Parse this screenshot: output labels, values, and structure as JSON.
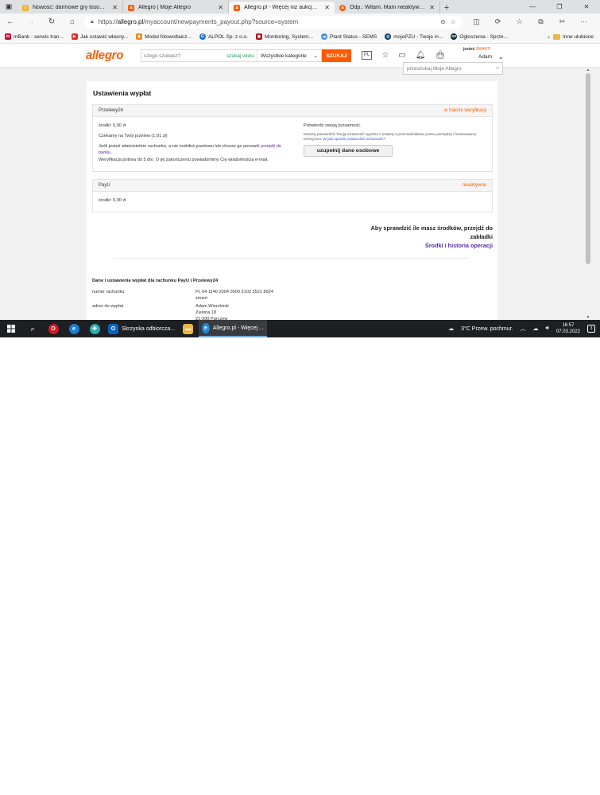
{
  "browser": {
    "tabs": [
      {
        "title": "Nowość: darmowe gry losowe z...",
        "icon": "smiley-icon",
        "color": "#f2b51b",
        "active": false
      },
      {
        "title": "Allegro | Moje Allegro",
        "icon": "allegro-icon",
        "color": "#ff5a00",
        "active": false
      },
      {
        "title": "Allegro.pl - Więcej niż aukcje. Na...",
        "icon": "allegro-icon",
        "color": "#ff5a00",
        "active": true
      },
      {
        "title": "Odp.: Witam. Mam nieaktywną w...",
        "icon": "allegro-icon",
        "color": "#ff5a00",
        "active": false
      }
    ],
    "url_prefix": "https://",
    "url_domain": "allegro.pl",
    "url_path": "/myaccount/newpayments_payout.php?source=system",
    "favorites": [
      {
        "label": "mBank - serwis tran...",
        "color": "#c8102e"
      },
      {
        "label": "Jak ustawić własny...",
        "color": "#e32626"
      },
      {
        "label": "Moduł fotowoltaicz...",
        "color": "#f28c18"
      },
      {
        "label": "ALPOL Sp. z o.o.",
        "color": "#1d6fd1"
      },
      {
        "label": "Monitoring, System...",
        "color": "#b5121b"
      },
      {
        "label": "Plant Status - SEMS",
        "color": "#3a93e8"
      },
      {
        "label": "mojePZU - Twoje in...",
        "color": "#003d7a"
      },
      {
        "label": "Ogłoszenia - Sprze...",
        "color": "#002f34"
      }
    ],
    "favorites_other": "Inne ulubione"
  },
  "allegro": {
    "logo": "allegro",
    "search_placeholder": "czego szukasz?",
    "search_wide": "szukaj wielu",
    "category": "Wszystkie kategorie",
    "search_button": "SZUKAJ",
    "lang": "PL",
    "smart_prefix": "jesteś",
    "smart": "SMART!",
    "user": "Adam"
  },
  "page": {
    "search_mine": "przeszukaj Moje Allegro",
    "title": "Ustawienia wypłat",
    "przelewy": {
      "name": "Przelewy24",
      "status": "w trakcie weryfikacji",
      "balance": "środki: 0,00 zł",
      "waiting": "Czekamy na Twój przelew (1,01 zł)",
      "owner_text": "Jeśli jesteś właścicielem rachunku, a nie zrobiłeś przelewu lub chcesz go ponowić",
      "owner_link_1": "przejdź do",
      "owner_link_2": "banku.",
      "verify_text": "Weryfikacja potrwa do 5 dni. O jej zakończeniu powiadomimy Cię wiadomością e-mail.",
      "confirm_title": "Potwierdź swoją tożsamość.",
      "confirm_desc_1": "Musimy potwierdzić Twoją tożsamość zgodnie z ustawą o przeciwdziałaniu praniu pieniędzy i finansowaniu",
      "confirm_desc_2": "terroryzmu.",
      "confirm_link": "W jaki sposób potwierdzić tożsamość?",
      "button": "uzupełnij dane osobowe"
    },
    "payu": {
      "name": "PayU",
      "status": "nieaktywne",
      "balance": "środki: 0,00 zł"
    },
    "hint_line": "Aby sprawdzić ile masz środków, przejdź do zakładki",
    "hint_link": "Środki i historia operacji",
    "section_title": "Dane i ustawienia wypłat dla rachunku PayU i Przelewy24",
    "account_label": "numer rachunku",
    "account_value": "PL 64 1140 2004 0000 3102 3521 8924",
    "account_change": "zmień",
    "address_label": "adres do wypłat",
    "address_lines": [
      "Adam Wierzbicki",
      "Zielona 18",
      "21-200 Parczew"
    ]
  },
  "taskbar": {
    "apps": [
      {
        "label": "Skrzynka odbiorcza...",
        "icon": "outlook-icon",
        "color": "#0a64c2",
        "active": false
      },
      {
        "label": "Allegro.pl - Więcej ...",
        "icon": "edge-icon",
        "color": "#1d8ad6",
        "active": true
      }
    ],
    "weather": "3°C  Przew. pochmur.",
    "time": "16:57",
    "date": "07.03.2022",
    "notif_count": "3"
  }
}
